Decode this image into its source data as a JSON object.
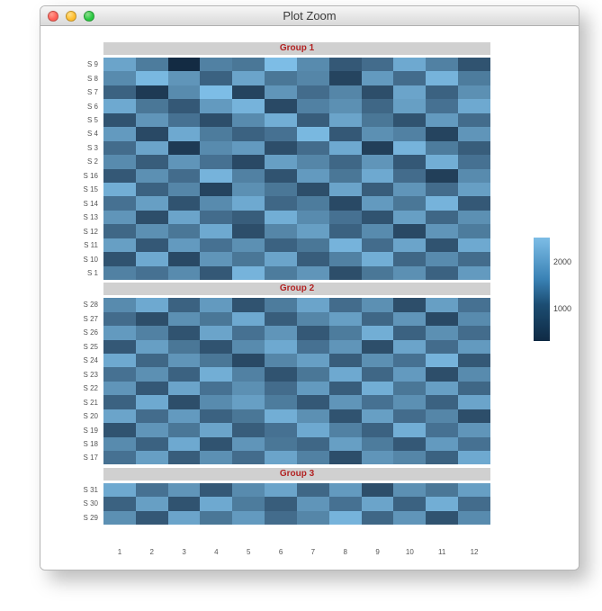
{
  "window": {
    "title": "Plot Zoom"
  },
  "chart_data": {
    "type": "heatmap",
    "xlabel": "",
    "ylabel": "",
    "x_categories": [
      "1",
      "2",
      "3",
      "4",
      "5",
      "6",
      "7",
      "8",
      "9",
      "10",
      "11",
      "12"
    ],
    "color_scale": {
      "low": "#132b43",
      "high": "#7dbde6",
      "breaks": [
        1000,
        2000
      ]
    },
    "facets": [
      {
        "label": "Group 1",
        "rows": [
          "S 9",
          "S 8",
          "S 7",
          "S 6",
          "S 5",
          "S 4",
          "S 3",
          "S 2",
          "S 16",
          "S 15",
          "S 14",
          "S 13",
          "S 12",
          "S 11",
          "S 10",
          "S 1"
        ],
        "values": [
          [
            1850,
            1450,
            650,
            1500,
            1400,
            2100,
            1600,
            1100,
            1300,
            1900,
            1500,
            1050
          ],
          [
            1600,
            2050,
            1700,
            1200,
            1850,
            1400,
            1550,
            900,
            1750,
            1300,
            2000,
            1450
          ],
          [
            1200,
            800,
            1600,
            2100,
            900,
            1700,
            1300,
            1550,
            1000,
            1850,
            1200,
            1650
          ],
          [
            1900,
            1400,
            1100,
            1750,
            2000,
            950,
            1500,
            1650,
            1250,
            1800,
            1350,
            1900
          ],
          [
            1050,
            1700,
            1350,
            1000,
            1600,
            1950,
            1150,
            1850,
            1400,
            1050,
            1750,
            1300
          ],
          [
            1750,
            950,
            1900,
            1450,
            1200,
            1350,
            2050,
            1100,
            1650,
            1500,
            900,
            1700
          ],
          [
            1300,
            1850,
            800,
            1600,
            1750,
            1000,
            1300,
            1900,
            850,
            2000,
            1450,
            1150
          ],
          [
            1600,
            1150,
            1700,
            1350,
            950,
            1800,
            1550,
            1250,
            1700,
            1100,
            1950,
            1350
          ],
          [
            1100,
            1650,
            1300,
            2000,
            1500,
            1050,
            1750,
            1400,
            1900,
            1300,
            850,
            1600
          ],
          [
            1950,
            1200,
            1550,
            900,
            1650,
            1400,
            1000,
            1850,
            1150,
            1700,
            1300,
            1800
          ],
          [
            1350,
            1800,
            1050,
            1600,
            1900,
            1250,
            1450,
            950,
            1750,
            1400,
            2000,
            1100
          ],
          [
            1700,
            1000,
            1850,
            1300,
            1150,
            1950,
            1600,
            1350,
            1050,
            1800,
            1250,
            1650
          ],
          [
            1250,
            1650,
            1400,
            1900,
            1000,
            1550,
            1800,
            1200,
            1600,
            950,
            1700,
            1450
          ],
          [
            1800,
            1100,
            1750,
            1350,
            1650,
            1200,
            1400,
            2000,
            1300,
            1850,
            1050,
            1900
          ],
          [
            1050,
            1900,
            950,
            1700,
            1400,
            1850,
            1150,
            1500,
            1950,
            1250,
            1600,
            1300
          ],
          [
            1500,
            1350,
            1600,
            1100,
            2000,
            1450,
            1700,
            1000,
            1400,
            1650,
            1200,
            1750
          ]
        ]
      },
      {
        "label": "Group 2",
        "rows": [
          "S 28",
          "S 27",
          "S 26",
          "S 25",
          "S 24",
          "S 23",
          "S 22",
          "S 21",
          "S 20",
          "S 19",
          "S 18",
          "S 17"
        ],
        "values": [
          [
            1600,
            1900,
            1200,
            1750,
            1050,
            1450,
            1850,
            1300,
            1650,
            1000,
            1800,
            1350
          ],
          [
            1300,
            1000,
            1650,
            1400,
            1900,
            1150,
            1550,
            1800,
            1250,
            1700,
            950,
            1600
          ],
          [
            1750,
            1500,
            1050,
            1850,
            1350,
            1700,
            1100,
            1450,
            1950,
            1200,
            1650,
            1300
          ],
          [
            1100,
            1800,
            1400,
            1050,
            1600,
            1900,
            1350,
            1700,
            1000,
            1850,
            1300,
            1750
          ],
          [
            1900,
            1250,
            1700,
            1400,
            950,
            1550,
            1800,
            1150,
            1650,
            1350,
            2000,
            1100
          ],
          [
            1350,
            1650,
            1200,
            1950,
            1500,
            1050,
            1400,
            1900,
            1250,
            1750,
            1000,
            1600
          ],
          [
            1700,
            1100,
            1850,
            1350,
            1650,
            1300,
            1750,
            1150,
            1950,
            1400,
            1800,
            1250
          ],
          [
            1200,
            1900,
            1000,
            1600,
            1800,
            1450,
            1100,
            1700,
            1350,
            1650,
            1200,
            1850
          ],
          [
            1850,
            1300,
            1750,
            1200,
            1400,
            1950,
            1650,
            1050,
            1800,
            1300,
            1550,
            1000
          ],
          [
            1050,
            1700,
            1400,
            1850,
            1150,
            1350,
            1900,
            1500,
            1200,
            1950,
            1350,
            1700
          ],
          [
            1600,
            1200,
            1900,
            1050,
            1700,
            1400,
            1250,
            1800,
            1450,
            1100,
            1750,
            1350
          ],
          [
            1350,
            1800,
            1150,
            1650,
            1300,
            1850,
            1500,
            1000,
            1700,
            1550,
            1200,
            1900
          ]
        ]
      },
      {
        "label": "Group 3",
        "rows": [
          "S 31",
          "S 30",
          "S 29"
        ],
        "values": [
          [
            1900,
            1350,
            1700,
            1100,
            1600,
            1850,
            1250,
            1750,
            1000,
            1650,
            1400,
            1800
          ],
          [
            1200,
            1800,
            1050,
            1900,
            1450,
            1150,
            1700,
            1350,
            1850,
            1200,
            1950,
            1300
          ],
          [
            1650,
            1100,
            1850,
            1400,
            1750,
            1300,
            1550,
            2000,
            1250,
            1700,
            1050,
            1600
          ]
        ]
      }
    ]
  }
}
